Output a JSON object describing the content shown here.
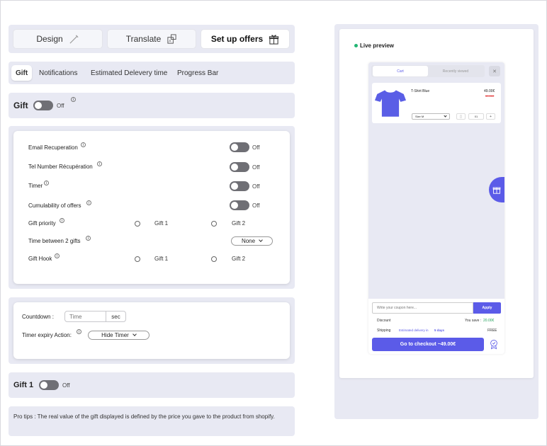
{
  "top_buttons": {
    "design": "Design",
    "translate": "Translate",
    "setup_offers": "Set up offers"
  },
  "tabs": [
    "Gift",
    "Notifications",
    "Estimated Delevery time",
    "Progress Bar"
  ],
  "gift_section": {
    "title": "Gift",
    "toggle_state": "Off"
  },
  "settings": {
    "email": {
      "label": "Email Recuperation",
      "state": "Off"
    },
    "tel": {
      "label": "Tel Number Récupération",
      "state": "Off"
    },
    "timer": {
      "label": "Timer",
      "state": "Off"
    },
    "cumulability": {
      "label": "Cumulability of offers",
      "state": "Off"
    },
    "priority": {
      "label": "Gift priority",
      "option1": "Gift 1",
      "option2": "Gift 2"
    },
    "time_between": {
      "label": "Time between 2 gifts",
      "value": "None"
    },
    "hook": {
      "label": "Gift Hook",
      "option1": "Gift 1",
      "option2": "Gift 2"
    }
  },
  "countdown": {
    "label": "Countdown :",
    "placeholder": "Time",
    "unit": "sec",
    "expiry_label": "Timer expiry Action:",
    "expiry_value": "Hide Timer"
  },
  "gift1": {
    "title": "Gift 1",
    "state": "Off"
  },
  "pro_tips": "Pro tips : The real value of the gift displayed is defined by the price you gave to the product from shopify.",
  "preview": {
    "title": "Live preview",
    "tab_cart": "Cart",
    "tab_recent": "Recently viewed",
    "close": "✕",
    "product_name": "T-Shirt Blue",
    "price": "49.00€",
    "old_price": "59.00€",
    "size": "Size M",
    "qty": "01",
    "coupon_placeholder": "Write your coupon here...",
    "apply": "Apply",
    "discount_label": "Discount",
    "you_save_label": "You save :",
    "you_save_value": "20.00€",
    "shipping_label": "Shipping",
    "shipping_est": "Estimated delivery in",
    "shipping_days": "5 days",
    "shipping_value": "FREE",
    "checkout": "Go to checkout ~49.00€"
  },
  "colors": {
    "accent": "#5b5be8",
    "panel": "#e8e9f3",
    "live_dot": "#22b573",
    "tshirt": "#5a5ee6",
    "save_green": "#22a05a",
    "old_price_red": "#e23b3b"
  }
}
